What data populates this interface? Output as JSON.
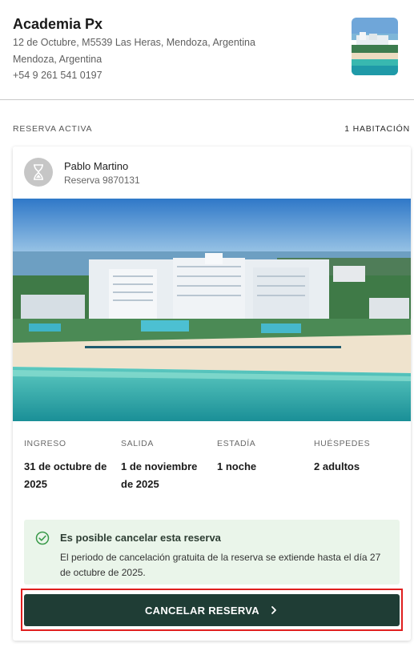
{
  "hotel": {
    "name": "Academia Px",
    "address_line1": "12 de Octubre, M5539 Las Heras, Mendoza, Argentina",
    "address_line2": "Mendoza, Argentina",
    "phone": "+54 9 261 541 0197",
    "thumbnail_icon": "hotel-thumbnail"
  },
  "reservation_section": {
    "label": "RESERVA ACTIVA",
    "rooms": "1 HABITACIÓN"
  },
  "booking": {
    "guest_name": "Pablo Martino",
    "reservation": "Reserva 9870131",
    "status_icon": "hourglass-icon",
    "details": [
      {
        "label": "INGRESO",
        "value": "31 de octubre de 2025"
      },
      {
        "label": "SALIDA",
        "value": "1 de noviembre de 2025"
      },
      {
        "label": "ESTADÍA",
        "value": "1 noche"
      },
      {
        "label": "HUÉSPEDES",
        "value": "2 adultos"
      }
    ],
    "cancellation": {
      "title": "Es posible cancelar esta reserva",
      "body": "El periodo de cancelación gratuita de la reserva se extiende hasta el día 27 de octubre de 2025.",
      "icon": "check-circle-icon"
    },
    "cancel_button_label": "CANCELAR RESERVA"
  },
  "colors": {
    "button": "#1f3d35",
    "notice_bg": "#eaf5ea",
    "highlight": "#e01e1e"
  }
}
